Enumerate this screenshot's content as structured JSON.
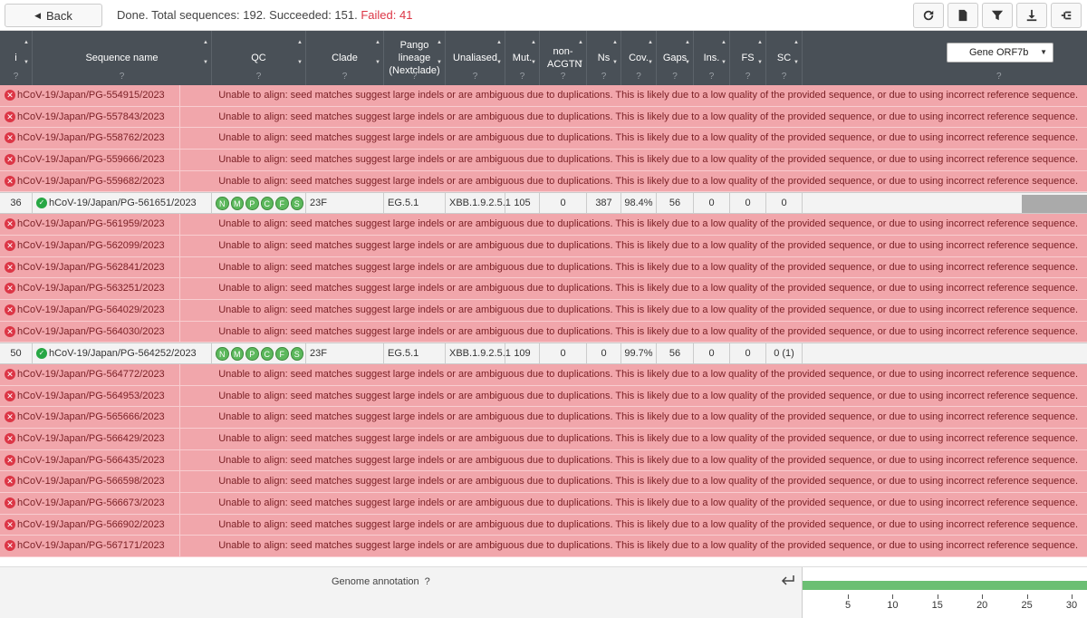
{
  "toolbar": {
    "back_label": "Back",
    "status_prefix": "Done. Total sequences: 192. Succeeded: 151. ",
    "status_failed": "Failed: 41",
    "tools": [
      "refresh-icon",
      "file-icon",
      "filter-icon",
      "download-icon",
      "tree-icon"
    ]
  },
  "columns": {
    "index": "i",
    "seqname": "Sequence name",
    "qc": "QC",
    "clade": "Clade",
    "pango": "Pango lineage (Nextclade)",
    "unaliased": "Unaliased",
    "mut": "Mut.",
    "nonacgtn": "non-ACGTN",
    "ns": "Ns",
    "cov": "Cov.",
    "gaps": "Gaps",
    "ins": "Ins.",
    "fs": "FS",
    "sc": "SC",
    "help": "?"
  },
  "gene_select": "Gene ORF7b",
  "error_message": "Unable to align: seed matches suggest large indels or are ambiguous due to duplications. This is likely due to a low quality of the provided sequence, or due to using incorrect reference sequence.",
  "rows": [
    {
      "status": "fail",
      "name": "hCoV-19/Japan/PG-554915/2023"
    },
    {
      "status": "fail",
      "name": "hCoV-19/Japan/PG-557843/2023"
    },
    {
      "status": "fail",
      "name": "hCoV-19/Japan/PG-558762/2023"
    },
    {
      "status": "fail",
      "name": "hCoV-19/Japan/PG-559666/2023"
    },
    {
      "status": "fail",
      "name": "hCoV-19/Japan/PG-559682/2023"
    },
    {
      "status": "ok",
      "index": "36",
      "name": "hCoV-19/Japan/PG-561651/2023",
      "qc": [
        "N",
        "M",
        "P",
        "C",
        "F",
        "S"
      ],
      "clade": "23F",
      "pango": "EG.5.1",
      "unaliased": "XBB.1.9.2.5.1",
      "mut": "105",
      "nonacgtn": "0",
      "ns": "387",
      "cov": "98.4%",
      "gaps": "56",
      "ins": "0",
      "fs": "0",
      "sc": "0",
      "covbar": true
    },
    {
      "status": "fail",
      "name": "hCoV-19/Japan/PG-561959/2023"
    },
    {
      "status": "fail",
      "name": "hCoV-19/Japan/PG-562099/2023"
    },
    {
      "status": "fail",
      "name": "hCoV-19/Japan/PG-562841/2023"
    },
    {
      "status": "fail",
      "name": "hCoV-19/Japan/PG-563251/2023"
    },
    {
      "status": "fail",
      "name": "hCoV-19/Japan/PG-564029/2023"
    },
    {
      "status": "fail",
      "name": "hCoV-19/Japan/PG-564030/2023"
    },
    {
      "status": "ok",
      "index": "50",
      "name": "hCoV-19/Japan/PG-564252/2023",
      "qc": [
        "N",
        "M",
        "P",
        "C",
        "F",
        "S"
      ],
      "clade": "23F",
      "pango": "EG.5.1",
      "unaliased": "XBB.1.9.2.5.1",
      "mut": "109",
      "nonacgtn": "0",
      "ns": "0",
      "cov": "99.7%",
      "gaps": "56",
      "ins": "0",
      "fs": "0",
      "sc": "0 (1)",
      "covbar": false
    },
    {
      "status": "fail",
      "name": "hCoV-19/Japan/PG-564772/2023"
    },
    {
      "status": "fail",
      "name": "hCoV-19/Japan/PG-564953/2023"
    },
    {
      "status": "fail",
      "name": "hCoV-19/Japan/PG-565666/2023"
    },
    {
      "status": "fail",
      "name": "hCoV-19/Japan/PG-566429/2023"
    },
    {
      "status": "fail",
      "name": "hCoV-19/Japan/PG-566435/2023"
    },
    {
      "status": "fail",
      "name": "hCoV-19/Japan/PG-566598/2023"
    },
    {
      "status": "fail",
      "name": "hCoV-19/Japan/PG-566673/2023"
    },
    {
      "status": "fail",
      "name": "hCoV-19/Japan/PG-566902/2023"
    },
    {
      "status": "fail",
      "name": "hCoV-19/Japan/PG-567171/2023"
    }
  ],
  "bottom": {
    "genome_annotation": "Genome annotation",
    "help": "?",
    "ticks": [
      "5",
      "10",
      "15",
      "20",
      "25",
      "30"
    ]
  }
}
